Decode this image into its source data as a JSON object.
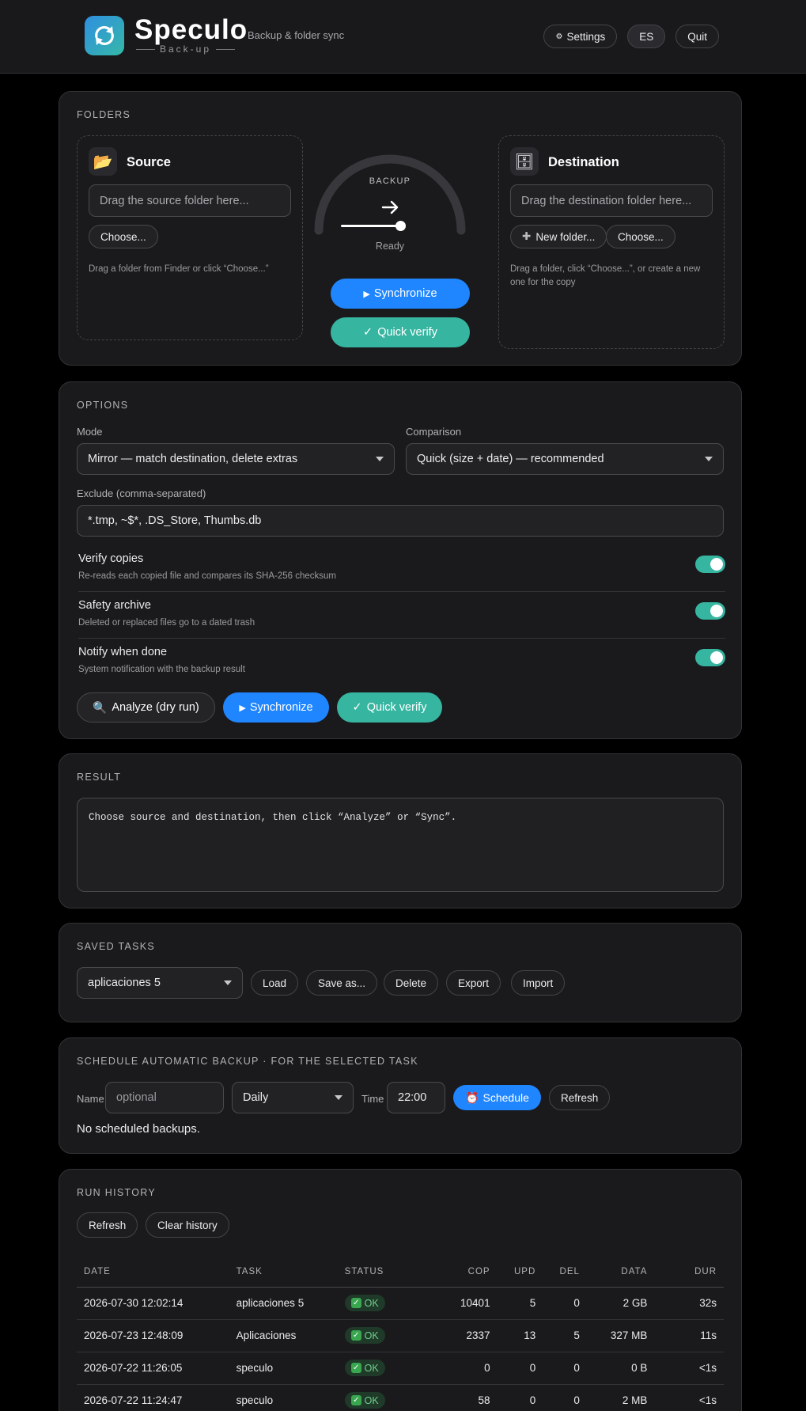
{
  "app": {
    "brand": "Speculo",
    "brand_sub": "Back-up",
    "tagline": "Backup & folder sync",
    "header_buttons": {
      "settings": "Settings",
      "language": "ES",
      "quit": "Quit"
    }
  },
  "folders": {
    "title": "FOLDERS",
    "source": {
      "title": "Source",
      "placeholder": "Drag the source folder here...",
      "choose": "Choose...",
      "hint": "Drag a folder from Finder or click “Choose...”"
    },
    "gauge": {
      "label": "BACKUP",
      "status": "Ready"
    },
    "synchronize": "Synchronize",
    "quick_verify": "Quick verify",
    "destination": {
      "title": "Destination",
      "placeholder": "Drag the destination folder here...",
      "new_folder": "New folder...",
      "choose": "Choose...",
      "hint": "Drag a folder, click “Choose...”, or create a new one for the copy"
    }
  },
  "options": {
    "title": "OPTIONS",
    "mode_label": "Mode",
    "mode_value": "Mirror — match destination, delete extras",
    "comparison_label": "Comparison",
    "comparison_value": "Quick (size + date) — recommended",
    "exclude_label": "Exclude (comma-separated)",
    "exclude_value": "*.tmp, ~$*, .DS_Store, Thumbs.db",
    "toggles": [
      {
        "title": "Verify copies",
        "desc": "Re-reads each copied file and compares its SHA-256 checksum",
        "on": true
      },
      {
        "title": "Safety archive",
        "desc": "Deleted or replaced files go to a dated trash",
        "on": true
      },
      {
        "title": "Notify when done",
        "desc": "System notification with the backup result",
        "on": true
      }
    ],
    "analyze": "Analyze (dry run)",
    "synchronize": "Synchronize",
    "quick_verify": "Quick verify"
  },
  "result": {
    "title": "RESULT",
    "text": "Choose source and destination, then click “Analyze” or “Sync”."
  },
  "saved_tasks": {
    "title": "SAVED TASKS",
    "selected": "aplicaciones 5",
    "buttons": {
      "load": "Load",
      "save_as": "Save as...",
      "delete": "Delete",
      "export": "Export",
      "import": "Import"
    }
  },
  "schedule": {
    "title": "SCHEDULE AUTOMATIC BACKUP · FOR THE SELECTED TASK",
    "name_label": "Name",
    "name_placeholder": "optional",
    "frequency": "Daily",
    "time_label": "Time",
    "time_value": "22:00",
    "schedule_button": "Schedule",
    "refresh_button": "Refresh",
    "empty_text": "No scheduled backups."
  },
  "history": {
    "title": "RUN HISTORY",
    "refresh": "Refresh",
    "clear": "Clear history",
    "columns": {
      "date": "DATE",
      "task": "TASK",
      "status": "STATUS",
      "cop": "COP",
      "upd": "UPD",
      "del": "DEL",
      "data": "DATA",
      "dur": "DUR"
    },
    "rows": [
      {
        "date": "2026-07-30 12:02:14",
        "task": "aplicaciones 5",
        "status": "OK",
        "cop": "10401",
        "upd": "5",
        "del": "0",
        "data": "2 GB",
        "dur": "32s"
      },
      {
        "date": "2026-07-23 12:48:09",
        "task": "Aplicaciones",
        "status": "OK",
        "cop": "2337",
        "upd": "13",
        "del": "5",
        "data": "327 MB",
        "dur": "11s"
      },
      {
        "date": "2026-07-22 11:26:05",
        "task": "speculo",
        "status": "OK",
        "cop": "0",
        "upd": "0",
        "del": "0",
        "data": "0 B",
        "dur": "<1s"
      },
      {
        "date": "2026-07-22 11:24:47",
        "task": "speculo",
        "status": "OK",
        "cop": "58",
        "upd": "0",
        "del": "0",
        "data": "2 MB",
        "dur": "<1s"
      }
    ]
  },
  "colors": {
    "accent_blue": "#1f86ff",
    "accent_teal": "#36b5a0",
    "ok_green": "#6fd08d"
  }
}
